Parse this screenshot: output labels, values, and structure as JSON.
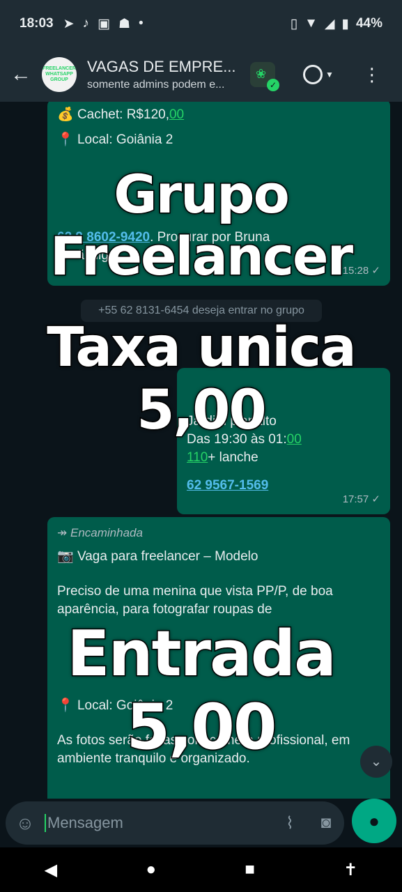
{
  "status_bar": {
    "time": "18:03",
    "battery": "44%",
    "left_icons": [
      "telegram-icon",
      "tiktok-icon",
      "bank-icon",
      "android-icon",
      "dot-icon"
    ],
    "right_icons": [
      "vibrate-icon",
      "wifi-icon",
      "signal-icon",
      "battery-icon"
    ]
  },
  "header": {
    "title": "VAGAS DE EMPRE...",
    "subtitle": "somente admins podem e...",
    "avatar_text": "FREELANCER WHATSAPP GROUP"
  },
  "messages": {
    "msg1": {
      "cachet_prefix": "Cachet: R$120,",
      "cachet_cents": "00",
      "local": "Local: Goiânia 2",
      "phone": "62 9 8602-9420",
      "instruction": ". Procurar por Bruna",
      "no_call": "E não ligar",
      "time": "15:28"
    },
    "system": "+55 62 8131-6454 deseja entrar no grupo",
    "msg2": {
      "line1": "Jardim planalto",
      "line2_prefix": "Das 19:30 às 01:",
      "line2_suffix": "00",
      "line3_prefix": "110",
      "line3_suffix": "+ lanche",
      "phone": "62 9567-1569",
      "time": "17:57"
    },
    "msg3": {
      "forwarded": "Encaminhada",
      "title": "Vaga para freelancer – Modelo",
      "body1": "Preciso de uma menina que vista PP/P, de boa aparência, para fotografar roupas de",
      "local": "Local: Goiânia 2",
      "body2": "As fotos serão feitas com câmera profissional, em ambiente tranquilo e organizado."
    }
  },
  "overlay": {
    "line1": "Grupo Freelancer",
    "line2": "Taxa unica 5,00",
    "line3": "Entrada 5,00"
  },
  "input": {
    "placeholder": "Mensagem"
  },
  "colors": {
    "bubble": "#005c4b",
    "accent": "#25d366",
    "background": "#0b141a"
  }
}
